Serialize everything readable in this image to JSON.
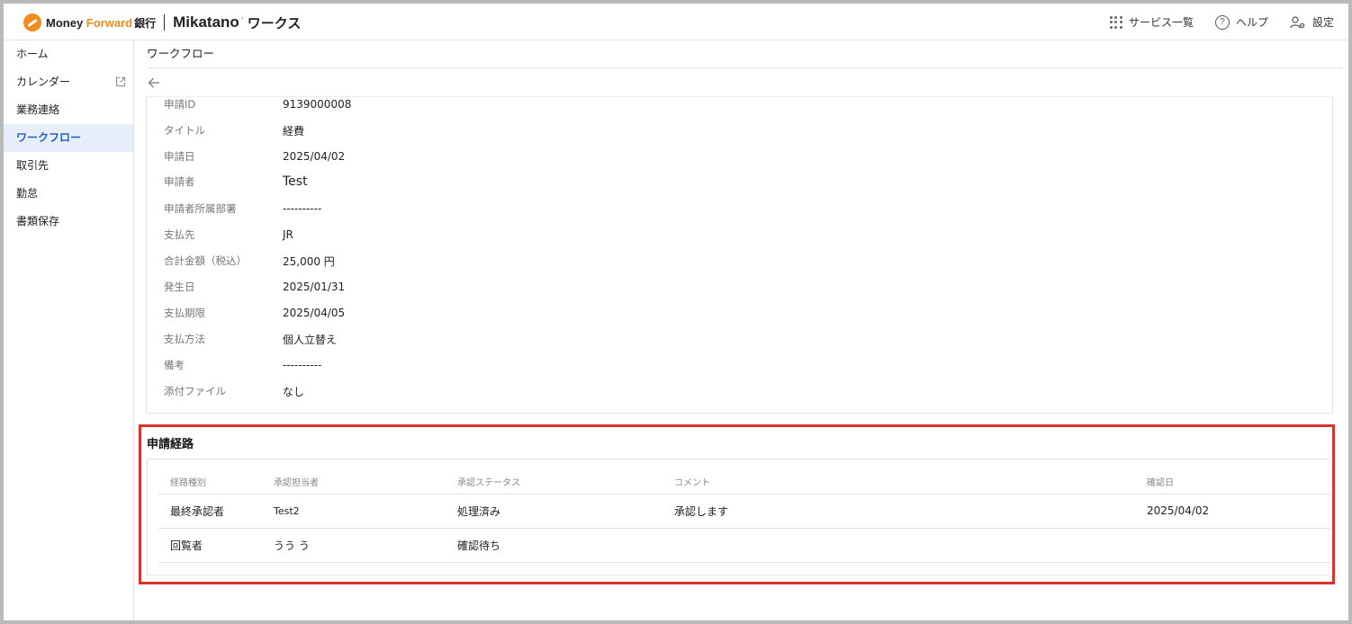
{
  "header": {
    "brand_money": "Money ",
    "brand_forward": "Forward",
    "brand_bank": "銀行",
    "brand_mikatano": "Mikatano",
    "brand_works": "ワークス",
    "services_label": "サービス一覧",
    "help_label": "ヘルプ",
    "settings_label": "設定"
  },
  "sidebar": {
    "items": [
      {
        "label": "ホーム"
      },
      {
        "label": "カレンダー"
      },
      {
        "label": "業務連絡"
      },
      {
        "label": "ワークフロー"
      },
      {
        "label": "取引先"
      },
      {
        "label": "勤怠"
      },
      {
        "label": "書類保存"
      }
    ],
    "active_index": 3
  },
  "page": {
    "title": "ワークフロー"
  },
  "details": [
    {
      "label": "申請ID",
      "value": "9139000008"
    },
    {
      "label": "タイトル",
      "value": "経費"
    },
    {
      "label": "申請日",
      "value": "2025/04/02"
    },
    {
      "label": "申請者",
      "value": "Test"
    },
    {
      "label": "申請者所属部署",
      "value": "----------"
    },
    {
      "label": "支払先",
      "value": "JR"
    },
    {
      "label": "合計金額（税込）",
      "value": "25,000 円"
    },
    {
      "label": "発生日",
      "value": "2025/01/31"
    },
    {
      "label": "支払期限",
      "value": "2025/04/05"
    },
    {
      "label": "支払方法",
      "value": "個人立替え"
    },
    {
      "label": "備考",
      "value": "----------"
    },
    {
      "label": "添付ファイル",
      "value": "なし"
    }
  ],
  "route": {
    "title": "申請経路",
    "columns": [
      "経路種別",
      "承認担当者",
      "承認ステータス",
      "コメント",
      "確認日"
    ],
    "rows": [
      [
        "最終承認者",
        "Test2",
        "処理済み",
        "承認します",
        "2025/04/02"
      ],
      [
        "回覧者",
        "うう う",
        "確認待ち",
        "",
        ""
      ]
    ]
  },
  "colors": {
    "accent": "#1d5fc4",
    "highlight_border": "#d9342b",
    "brand_orange": "#f08b1d"
  }
}
